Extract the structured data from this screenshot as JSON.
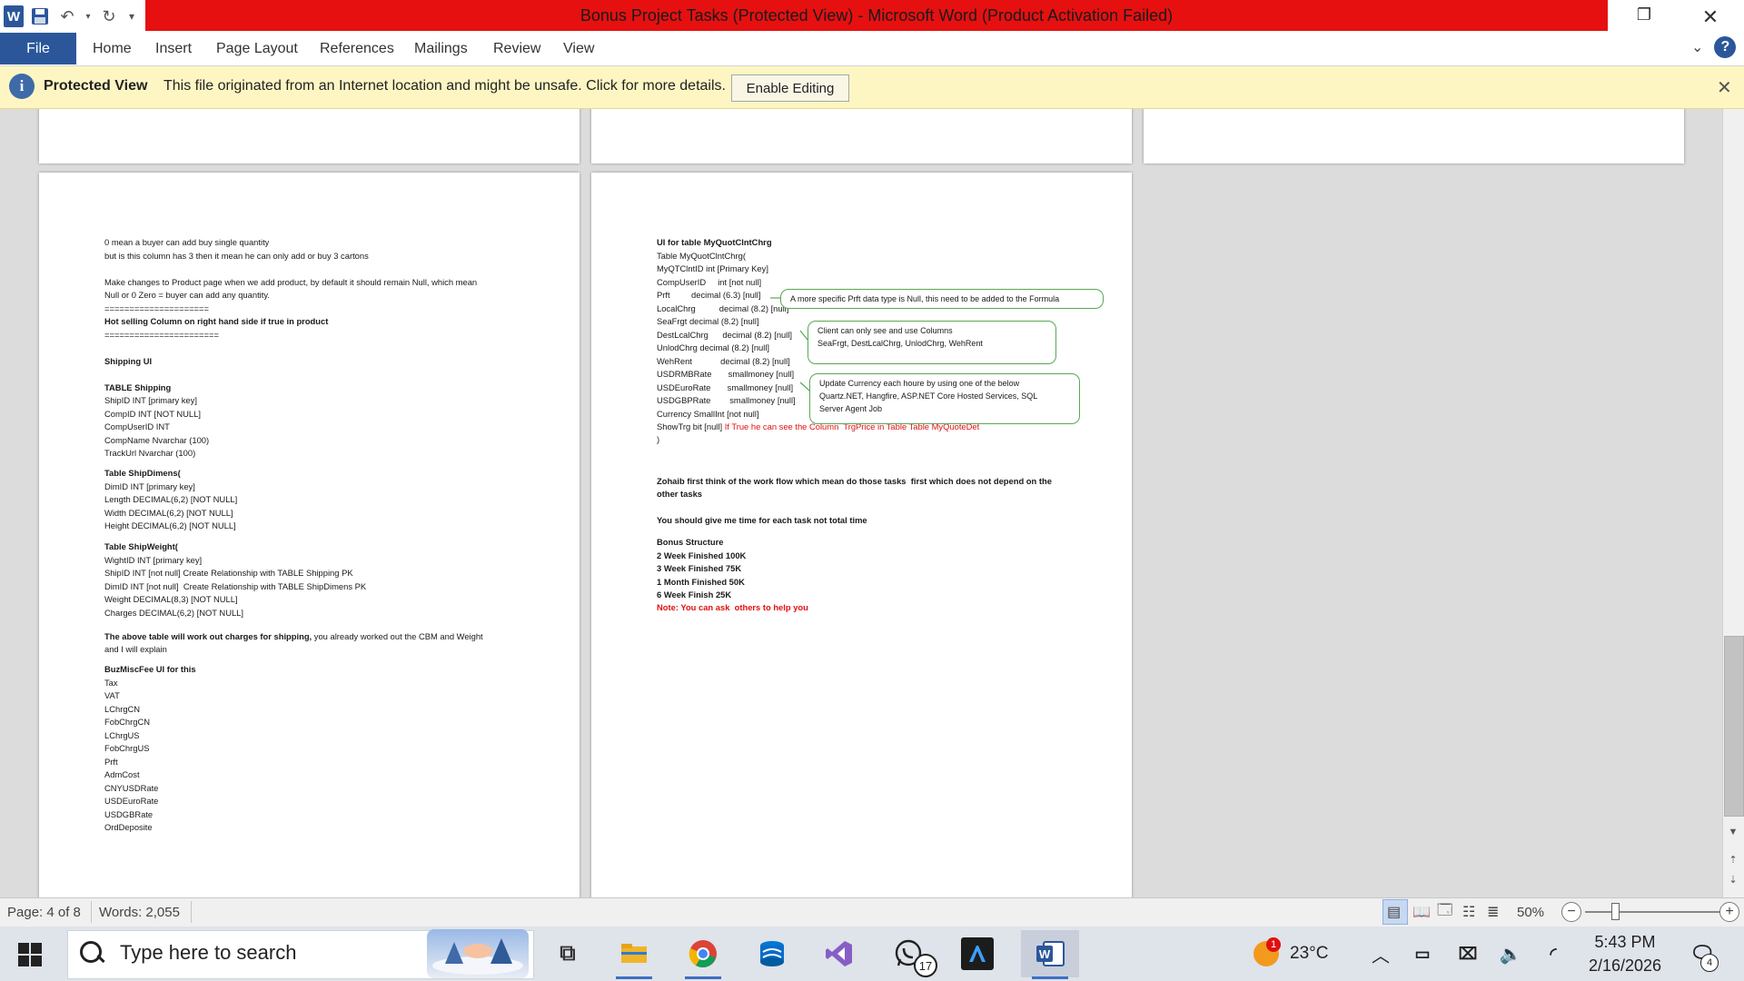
{
  "window": {
    "title": "Bonus Project Tasks (Protected View)  -  Microsoft Word (Product Activation Failed)",
    "app_badge": "W"
  },
  "ribbon": {
    "file": "File",
    "tabs": [
      "Home",
      "Insert",
      "Page Layout",
      "References",
      "Mailings",
      "Review",
      "View"
    ]
  },
  "protected_view": {
    "title": "Protected View",
    "message": "This file originated from an Internet location and might be unsafe. Click for more details.",
    "button": "Enable Editing"
  },
  "page_left": {
    "lines": [
      {
        "t": "0 mean a buyer can add buy single quantity",
        "s": ""
      },
      {
        "t": "but is this column has 3 then it mean he can only add or buy 3 cartons",
        "s": ""
      },
      {
        "t": "",
        "s": ""
      },
      {
        "t": "Make changes to Product page when we add product, by default it should remain Null, which mean",
        "s": ""
      },
      {
        "t": "Null or 0 Zero = buyer can add any quantity.",
        "s": ""
      },
      {
        "t": "=====================",
        "s": ""
      },
      {
        "t": "Hot selling Column on right hand side if true in product",
        "s": "b"
      },
      {
        "t": "=======================",
        "s": ""
      },
      {
        "t": "",
        "s": ""
      },
      {
        "t": "Shipping UI",
        "s": "b"
      },
      {
        "t": "",
        "s": ""
      },
      {
        "t": "TABLE Shipping",
        "s": "b"
      },
      {
        "t": "ShipID INT [primary key]",
        "s": ""
      },
      {
        "t": "CompID INT [NOT NULL]",
        "s": ""
      },
      {
        "t": "CompUserID INT",
        "s": ""
      },
      {
        "t": "CompName Nvarchar (100)",
        "s": ""
      },
      {
        "t": "TrackUrl Nvarchar (100)",
        "s": ""
      }
    ],
    "lines2": [
      {
        "t": "Table ShipDimens(",
        "s": "b"
      },
      {
        "t": "DimID INT [primary key]",
        "s": ""
      },
      {
        "t": "Length DECIMAL(6,2) [NOT NULL]",
        "s": ""
      },
      {
        "t": "Width DECIMAL(6,2) [NOT NULL]",
        "s": ""
      },
      {
        "t": "Height DECIMAL(6,2) [NOT NULL]",
        "s": ""
      }
    ],
    "lines3": [
      {
        "t": "Table ShipWeight(",
        "s": "b"
      },
      {
        "t": "WightID INT [primary key]",
        "s": ""
      },
      {
        "t": "ShipID INT [not null] Create Relationship with TABLE Shipping PK",
        "s": ""
      },
      {
        "t": "DimID INT [not null]  Create Relationship with TABLE ShipDimens PK",
        "s": ""
      },
      {
        "t": "Weight DECIMAL(8,3) [NOT NULL]",
        "s": ""
      },
      {
        "t": "Charges DECIMAL(6,2) [NOT NULL]",
        "s": ""
      }
    ],
    "charges_bold": "The above table will work out charges for shipping,",
    "charges_rest": " you already worked out the CBM and Weight",
    "charges_line2": "and I will explain",
    "lines4": [
      {
        "t": "BuzMiscFee UI for this",
        "s": "b"
      },
      {
        "t": "Tax",
        "s": ""
      },
      {
        "t": "VAT",
        "s": ""
      },
      {
        "t": "LChrgCN",
        "s": ""
      },
      {
        "t": "FobChrgCN",
        "s": ""
      },
      {
        "t": "LChrgUS",
        "s": ""
      },
      {
        "t": "FobChrgUS",
        "s": ""
      },
      {
        "t": "Prft",
        "s": ""
      },
      {
        "t": "AdmCost",
        "s": ""
      },
      {
        "t": "CNYUSDRate",
        "s": ""
      },
      {
        "t": "USDEuroRate",
        "s": ""
      },
      {
        "t": "USDGBRate",
        "s": ""
      },
      {
        "t": "OrdDeposite",
        "s": ""
      }
    ]
  },
  "page_right": {
    "lines": [
      {
        "t": "UI for table MyQuotClntChrg",
        "s": "b"
      },
      {
        "t": "Table MyQuotClntChrg(",
        "s": ""
      },
      {
        "t": "MyQTClntID int [Primary Key]",
        "s": ""
      },
      {
        "t": "CompUserID     int [not null]",
        "s": ""
      },
      {
        "t": "Prft         decimal (6.3) [null]",
        "s": ""
      },
      {
        "t": "LocalChrg          decimal (8.2) [null]",
        "s": ""
      },
      {
        "t": "SeaFrgt decimal (8.2) [null]",
        "s": ""
      },
      {
        "t": "DestLcalChrg      decimal (8.2) [null]",
        "s": ""
      },
      {
        "t": "UnlodChrg decimal (8.2) [null]",
        "s": ""
      },
      {
        "t": "WehRent            decimal (8.2) [null]",
        "s": ""
      },
      {
        "t": "USDRMBRate       smallmoney [null]",
        "s": ""
      },
      {
        "t": "USDEuroRate       smallmoney [null]",
        "s": ""
      },
      {
        "t": "USDGBPRate        smallmoney [null]",
        "s": ""
      },
      {
        "t": "Currency SmallInt [not null]",
        "s": ""
      }
    ],
    "showtrg": "ShowTrg bit [null]",
    "showtrg_note": "If True he can see the Column  TrgPrice in Table Table MyQuoteDet",
    "close_brace": ")",
    "zohaib_line1": "Zohaib first think of the work flow which mean do those tasks  first which does not depend on the",
    "zohaib_line2": "other tasks",
    "time_line": "You should give me time for each task not total time",
    "bonus": [
      {
        "t": "Bonus Structure",
        "s": "b"
      },
      {
        "t": "2 Week Finished 100K",
        "s": "b"
      },
      {
        "t": "3 Week Finished 75K",
        "s": "b"
      },
      {
        "t": "1 Month Finished 50K",
        "s": "b"
      },
      {
        "t": "6 Week Finish 25K",
        "s": "b"
      }
    ],
    "note": "Note: You can ask  others to help you",
    "comments": [
      "A more specific Prft data type is Null, this need to be added to the Formula",
      "Client can only see and use Columns\nSeaFrgt, DestLcalChrg, UnlodChrg, WehRent",
      "Update Currency each houre by using one of the below\nQuartz.NET, Hangfire, ASP.NET Core Hosted Services, SQL\nServer Agent Job"
    ]
  },
  "status": {
    "page": "Page: 4 of 8",
    "words": "Words: 2,055",
    "zoom": "50%"
  },
  "taskbar": {
    "search_placeholder": "Type here to search",
    "whatsapp_badge": "17",
    "weather_badge": "1",
    "temperature": "23°C",
    "time": "5:43 PM",
    "date": "2/16/2026",
    "notification_count": "4"
  }
}
